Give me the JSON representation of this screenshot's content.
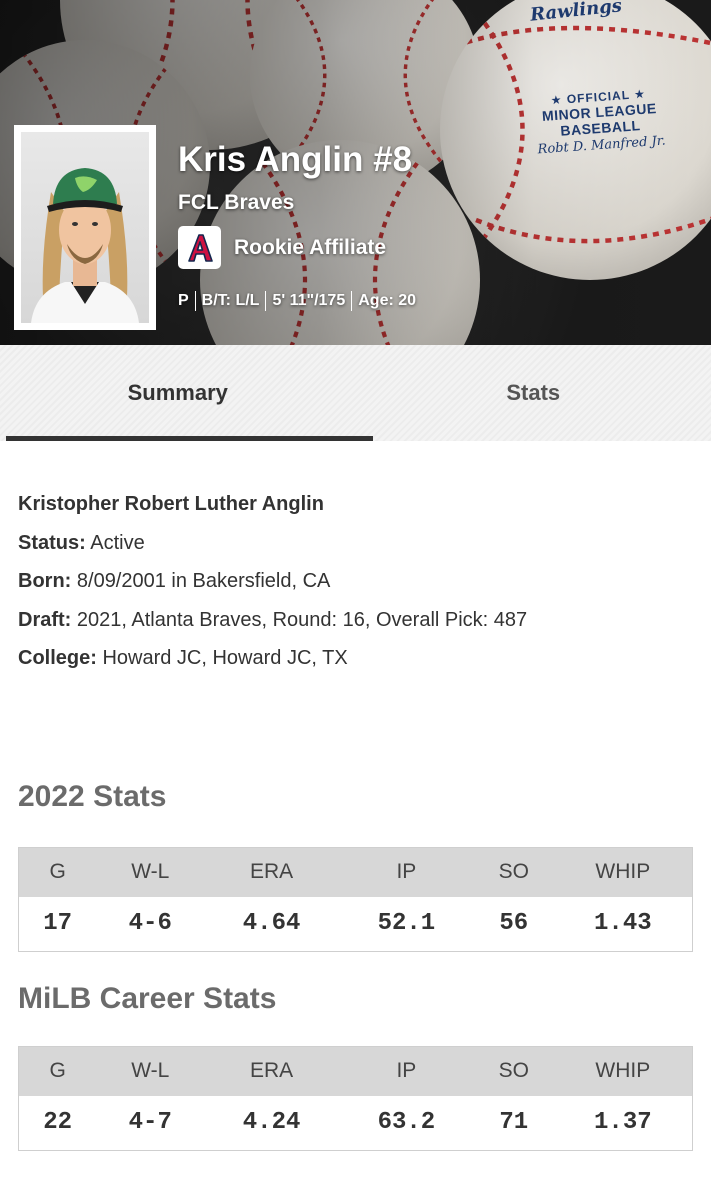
{
  "player": {
    "name": "Kris Anglin #8",
    "team": "FCL Braves",
    "affiliate": "Rookie Affiliate",
    "position": "P",
    "bats_throws": "B/T: L/L",
    "height_weight": "5' 11\"/175",
    "age": "Age: 20"
  },
  "hero": {
    "ball_brand": "Rawlings",
    "ball_stamp_line1": "★ OFFICIAL ★",
    "ball_stamp_line2": "MINOR LEAGUE BASEBALL",
    "ball_stamp_signature": "Robt D. Manfred Jr."
  },
  "tabs": [
    {
      "label": "Summary",
      "active": true
    },
    {
      "label": "Stats",
      "active": false
    }
  ],
  "bio": {
    "full_name": "Kristopher Robert Luther Anglin",
    "status_label": "Status:",
    "status_value": " Active",
    "born_label": "Born:",
    "born_value": " 8/09/2001 in Bakersfield, CA",
    "draft_label": "Draft:",
    "draft_value": " 2021, Atlanta Braves, Round: 16, Overall Pick: 487",
    "college_label": "College:",
    "college_value": " Howard JC, Howard JC, TX"
  },
  "stats_2022": {
    "title": "2022 Stats",
    "headers": [
      "G",
      "W-L",
      "ERA",
      "IP",
      "SO",
      "WHIP"
    ],
    "values": [
      "17",
      "4-6",
      "4.64",
      "52.1",
      "56",
      "1.43"
    ]
  },
  "stats_career": {
    "title": "MiLB Career Stats",
    "headers": [
      "G",
      "W-L",
      "ERA",
      "IP",
      "SO",
      "WHIP"
    ],
    "values": [
      "22",
      "4-7",
      "4.24",
      "63.2",
      "71",
      "1.37"
    ]
  },
  "colors": {
    "braves_red": "#ce1141",
    "braves_navy": "#13274f",
    "cap_green": "#2e7d4f"
  }
}
